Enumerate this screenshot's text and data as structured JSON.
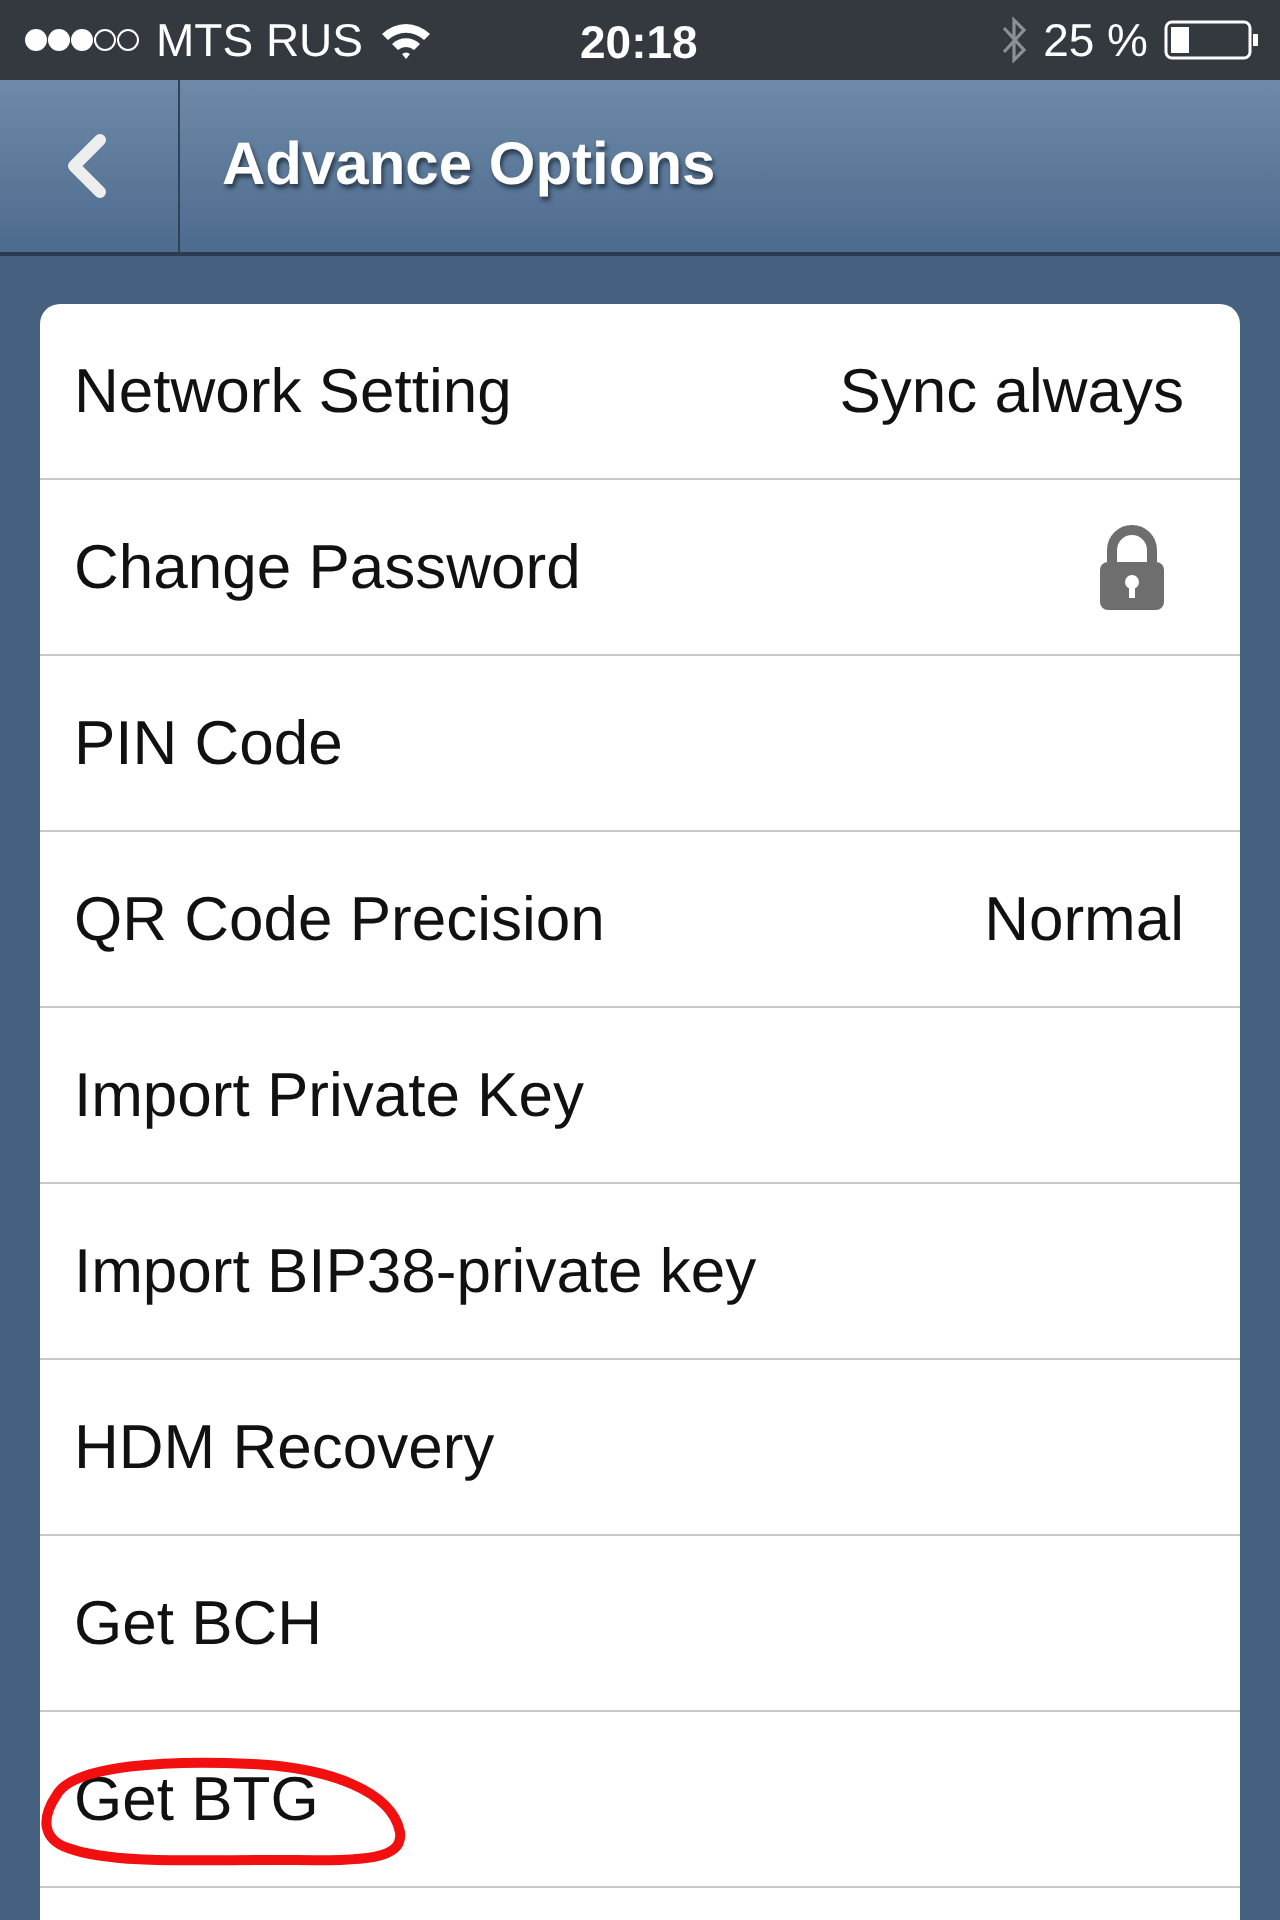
{
  "status_bar": {
    "carrier": "MTS RUS",
    "time": "20:18",
    "battery": "25 %"
  },
  "nav_bar": {
    "title": "Advance Options"
  },
  "settings": [
    {
      "kind": "value",
      "label": "Network Setting",
      "value": "Sync always",
      "circled": false
    },
    {
      "kind": "lock",
      "label": "Change Password",
      "circled": false
    },
    {
      "kind": "plain",
      "label": "PIN Code",
      "circled": false
    },
    {
      "kind": "value",
      "label": "QR Code Precision",
      "value": "Normal",
      "circled": false
    },
    {
      "kind": "plain",
      "label": "Import Private Key",
      "circled": false
    },
    {
      "kind": "plain",
      "label": "Import BIP38-private key",
      "circled": false
    },
    {
      "kind": "plain",
      "label": "HDM Recovery",
      "circled": false
    },
    {
      "kind": "plain",
      "label": "Get BCH",
      "circled": false
    },
    {
      "kind": "plain",
      "label": "Get BTG",
      "circled": true
    }
  ]
}
